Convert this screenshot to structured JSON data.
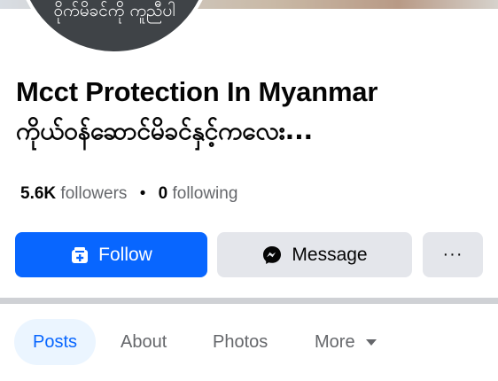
{
  "profile": {
    "avatar_text": "ဝိုက်မိခင်ကို ကူညီပါ",
    "name_line1": "Mcct Protection In Myanmar",
    "name_line2": "ကိုယ်ဝန်ဆောင်မိခင်နှင့်ကလေး..."
  },
  "stats": {
    "followers_count": "5.6K",
    "followers_label": "followers",
    "separator": "•",
    "following_count": "0",
    "following_label": "following"
  },
  "actions": {
    "follow_label": "Follow",
    "message_label": "Message",
    "more_label": "···"
  },
  "tabs": [
    {
      "label": "Posts",
      "active": true
    },
    {
      "label": "About"
    },
    {
      "label": "Photos"
    },
    {
      "label": "More"
    }
  ],
  "colors": {
    "primary": "#0866ff",
    "secondary_button": "#e4e6eb",
    "active_tab_bg": "#ebf5ff",
    "muted_text": "#65676b"
  },
  "icons": {
    "follow": "follow-page-icon",
    "message": "messenger-icon",
    "more": "more-dots-icon",
    "tab_more": "caret-down-icon"
  }
}
